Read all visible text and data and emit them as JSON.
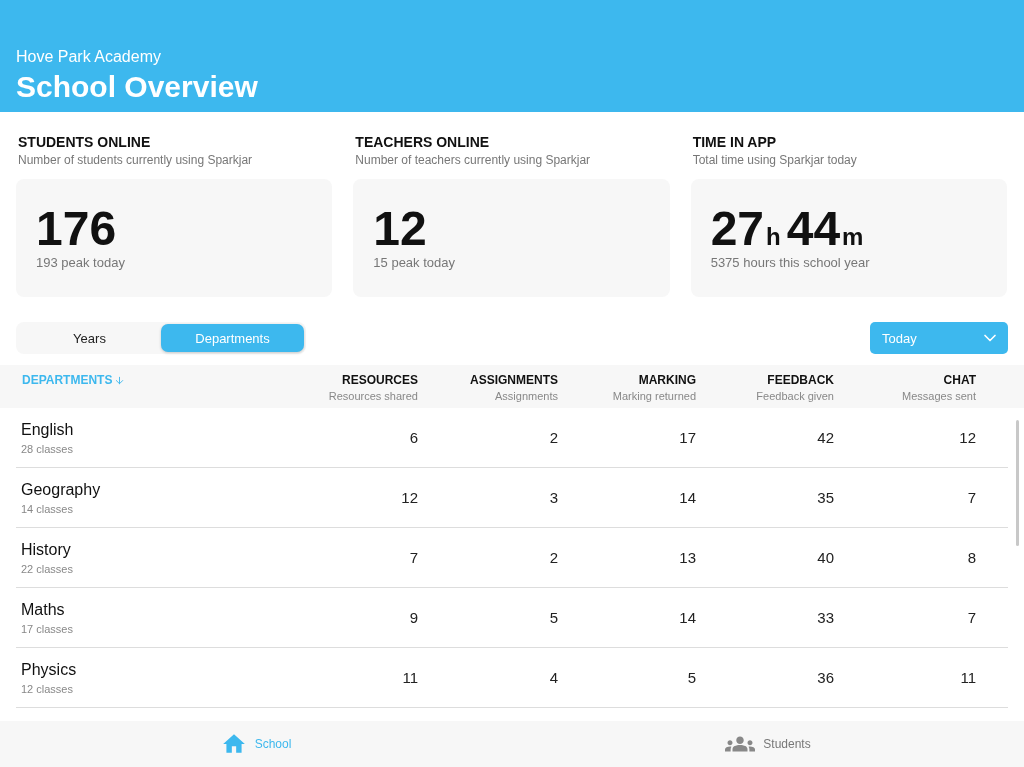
{
  "header": {
    "subtitle": "Hove Park Academy",
    "title": "School Overview"
  },
  "stats": [
    {
      "title": "STUDENTS ONLINE",
      "description": "Number of students currently using Sparkjar",
      "parts": [
        {
          "number": "176"
        }
      ],
      "note": "193 peak today"
    },
    {
      "title": "TEACHERS ONLINE",
      "description": "Number of teachers currently using Sparkjar",
      "parts": [
        {
          "number": "12"
        }
      ],
      "note": "15 peak today"
    },
    {
      "title": "TIME IN APP",
      "description": "Total time using Sparkjar today",
      "parts": [
        {
          "number": "27",
          "unit": "h"
        },
        {
          "number": "44",
          "unit": "m"
        }
      ],
      "note": "5375 hours this school year"
    }
  ],
  "segments": [
    {
      "label": "Years",
      "selected": false
    },
    {
      "label": "Departments",
      "selected": true
    }
  ],
  "period_dropdown": {
    "value": "Today"
  },
  "table": {
    "columns": [
      {
        "label": "DEPARTMENTS",
        "sorted": true
      },
      {
        "label": "RESOURCES",
        "caption": "Resources shared",
        "sorted": false
      },
      {
        "label": "ASSIGNMENTS",
        "caption": "Assignments",
        "sorted": false
      },
      {
        "label": "MARKING",
        "caption": "Marking returned",
        "sorted": false
      },
      {
        "label": "FEEDBACK",
        "caption": "Feedback given",
        "sorted": false
      },
      {
        "label": "CHAT",
        "caption": "Messages sent",
        "sorted": false
      }
    ],
    "rows": [
      {
        "name": "English",
        "classes": "28 classes",
        "values": [
          "6",
          "2",
          "17",
          "42",
          "12"
        ]
      },
      {
        "name": "Geography",
        "classes": "14 classes",
        "values": [
          "12",
          "3",
          "14",
          "35",
          "7"
        ]
      },
      {
        "name": "History",
        "classes": "22 classes",
        "values": [
          "7",
          "2",
          "13",
          "40",
          "8"
        ]
      },
      {
        "name": "Maths",
        "classes": "17 classes",
        "values": [
          "9",
          "5",
          "14",
          "33",
          "7"
        ]
      },
      {
        "name": "Physics",
        "classes": "12 classes",
        "values": [
          "11",
          "4",
          "5",
          "36",
          "11"
        ]
      }
    ]
  },
  "tab_bar": [
    {
      "kind": "home",
      "label": "School",
      "selected": true
    },
    {
      "kind": "people",
      "label": "Students",
      "selected": false
    }
  ]
}
